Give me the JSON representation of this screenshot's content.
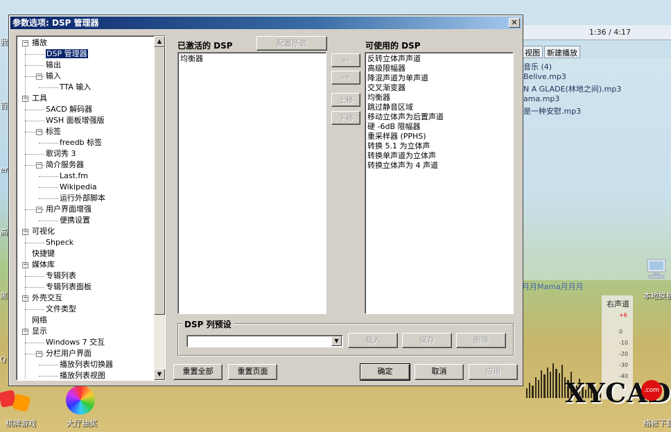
{
  "desktop": {
    "left_labels": [
      "我",
      "百",
      "ern",
      "高",
      "黑",
      "Q"
    ],
    "bottom_icons": [
      {
        "label": "棋牌游戏"
      },
      {
        "label": "大厅抽奖"
      }
    ],
    "right_icon": {
      "label": "本地换机"
    },
    "right_bottom_label": "络帐下载",
    "watermark": "XYCAD",
    "watermark_com": ".com"
  },
  "player": {
    "time": "1:36 / 4:17",
    "tabs": [
      "视图",
      "新建播放"
    ],
    "lines": [
      "音乐 (4)",
      "Belive.mp3",
      "N A GLADE(林地之间).mp3",
      "ama.mp3",
      "是一种安慰.mp3"
    ],
    "fav": "月月Mama月月月",
    "vol_title": "右声道",
    "vol_scale": [
      "+6",
      "0",
      "-10",
      "-20",
      "-30",
      "-40"
    ]
  },
  "dialog": {
    "title": "参数选项: DSP 管理器",
    "close": "✕",
    "tree": [
      {
        "label": "播放",
        "level": 0,
        "exp": "−"
      },
      {
        "label": "DSP 管理器",
        "level": 1,
        "selected": true
      },
      {
        "label": "输出",
        "level": 1
      },
      {
        "label": "输入",
        "level": 1,
        "exp": "−"
      },
      {
        "label": "TTA 输入",
        "level": 2
      },
      {
        "label": "工具",
        "level": 0,
        "exp": "−"
      },
      {
        "label": "SACD 解码器",
        "level": 1
      },
      {
        "label": "WSH 面板增强版",
        "level": 1
      },
      {
        "label": "标签",
        "level": 1,
        "exp": "−"
      },
      {
        "label": "freedb 标签",
        "level": 2
      },
      {
        "label": "歌词秀 3",
        "level": 1
      },
      {
        "label": "简介服务器",
        "level": 1,
        "exp": "−"
      },
      {
        "label": "Last.fm",
        "level": 2
      },
      {
        "label": "Wikipedia",
        "level": 2
      },
      {
        "label": "运行外部脚本",
        "level": 2
      },
      {
        "label": "用户界面增强",
        "level": 1,
        "exp": "−"
      },
      {
        "label": "便携设置",
        "level": 2
      },
      {
        "label": "可视化",
        "level": 0,
        "exp": "−"
      },
      {
        "label": "Shpeck",
        "level": 1
      },
      {
        "label": "快捷键",
        "level": 0
      },
      {
        "label": "媒体库",
        "level": 0,
        "exp": "−"
      },
      {
        "label": "专辑列表",
        "level": 1
      },
      {
        "label": "专辑列表面板",
        "level": 1
      },
      {
        "label": "外壳交互",
        "level": 0,
        "exp": "−"
      },
      {
        "label": "文件类型",
        "level": 1
      },
      {
        "label": "网络",
        "level": 0
      },
      {
        "label": "显示",
        "level": 0,
        "exp": "−"
      },
      {
        "label": "Windows 7 交互",
        "level": 1
      },
      {
        "label": "分栏用户界面",
        "level": 1,
        "exp": "−"
      },
      {
        "label": "播放列表切换器",
        "level": 2
      },
      {
        "label": "播放列表视图",
        "level": 2
      }
    ],
    "active_label": "已激活的 DSP",
    "configure_selected": "配置所选",
    "active_items": [
      "均衡器"
    ],
    "available_label": "可使用的 DSP",
    "available_items": [
      "反转立体声声道",
      "高级限幅器",
      "降混声道为单声道",
      "交叉渐变器",
      "均衡器",
      "跳过静音区域",
      "移动立体声为后置声道",
      "硬 -6dB 限幅器",
      "重采样器 (PPHS)",
      "转换 5.1 为立体声",
      "转换单声道为立体声",
      "转换立体声为 4 声道"
    ],
    "arrow_left": "⇦",
    "arrow_right": "⇨",
    "move_up": "上移",
    "move_down": "下移",
    "preset_group": "DSP 列预设",
    "preset_value": "",
    "load": "载入",
    "save": "保存",
    "delete": "删除",
    "reset_all": "重置全部",
    "reset_page": "重置页面",
    "ok": "确定",
    "cancel": "取消",
    "apply": "应用",
    "scroll_up": "▲",
    "scroll_down": "▼",
    "combo_arrow": "▼"
  }
}
